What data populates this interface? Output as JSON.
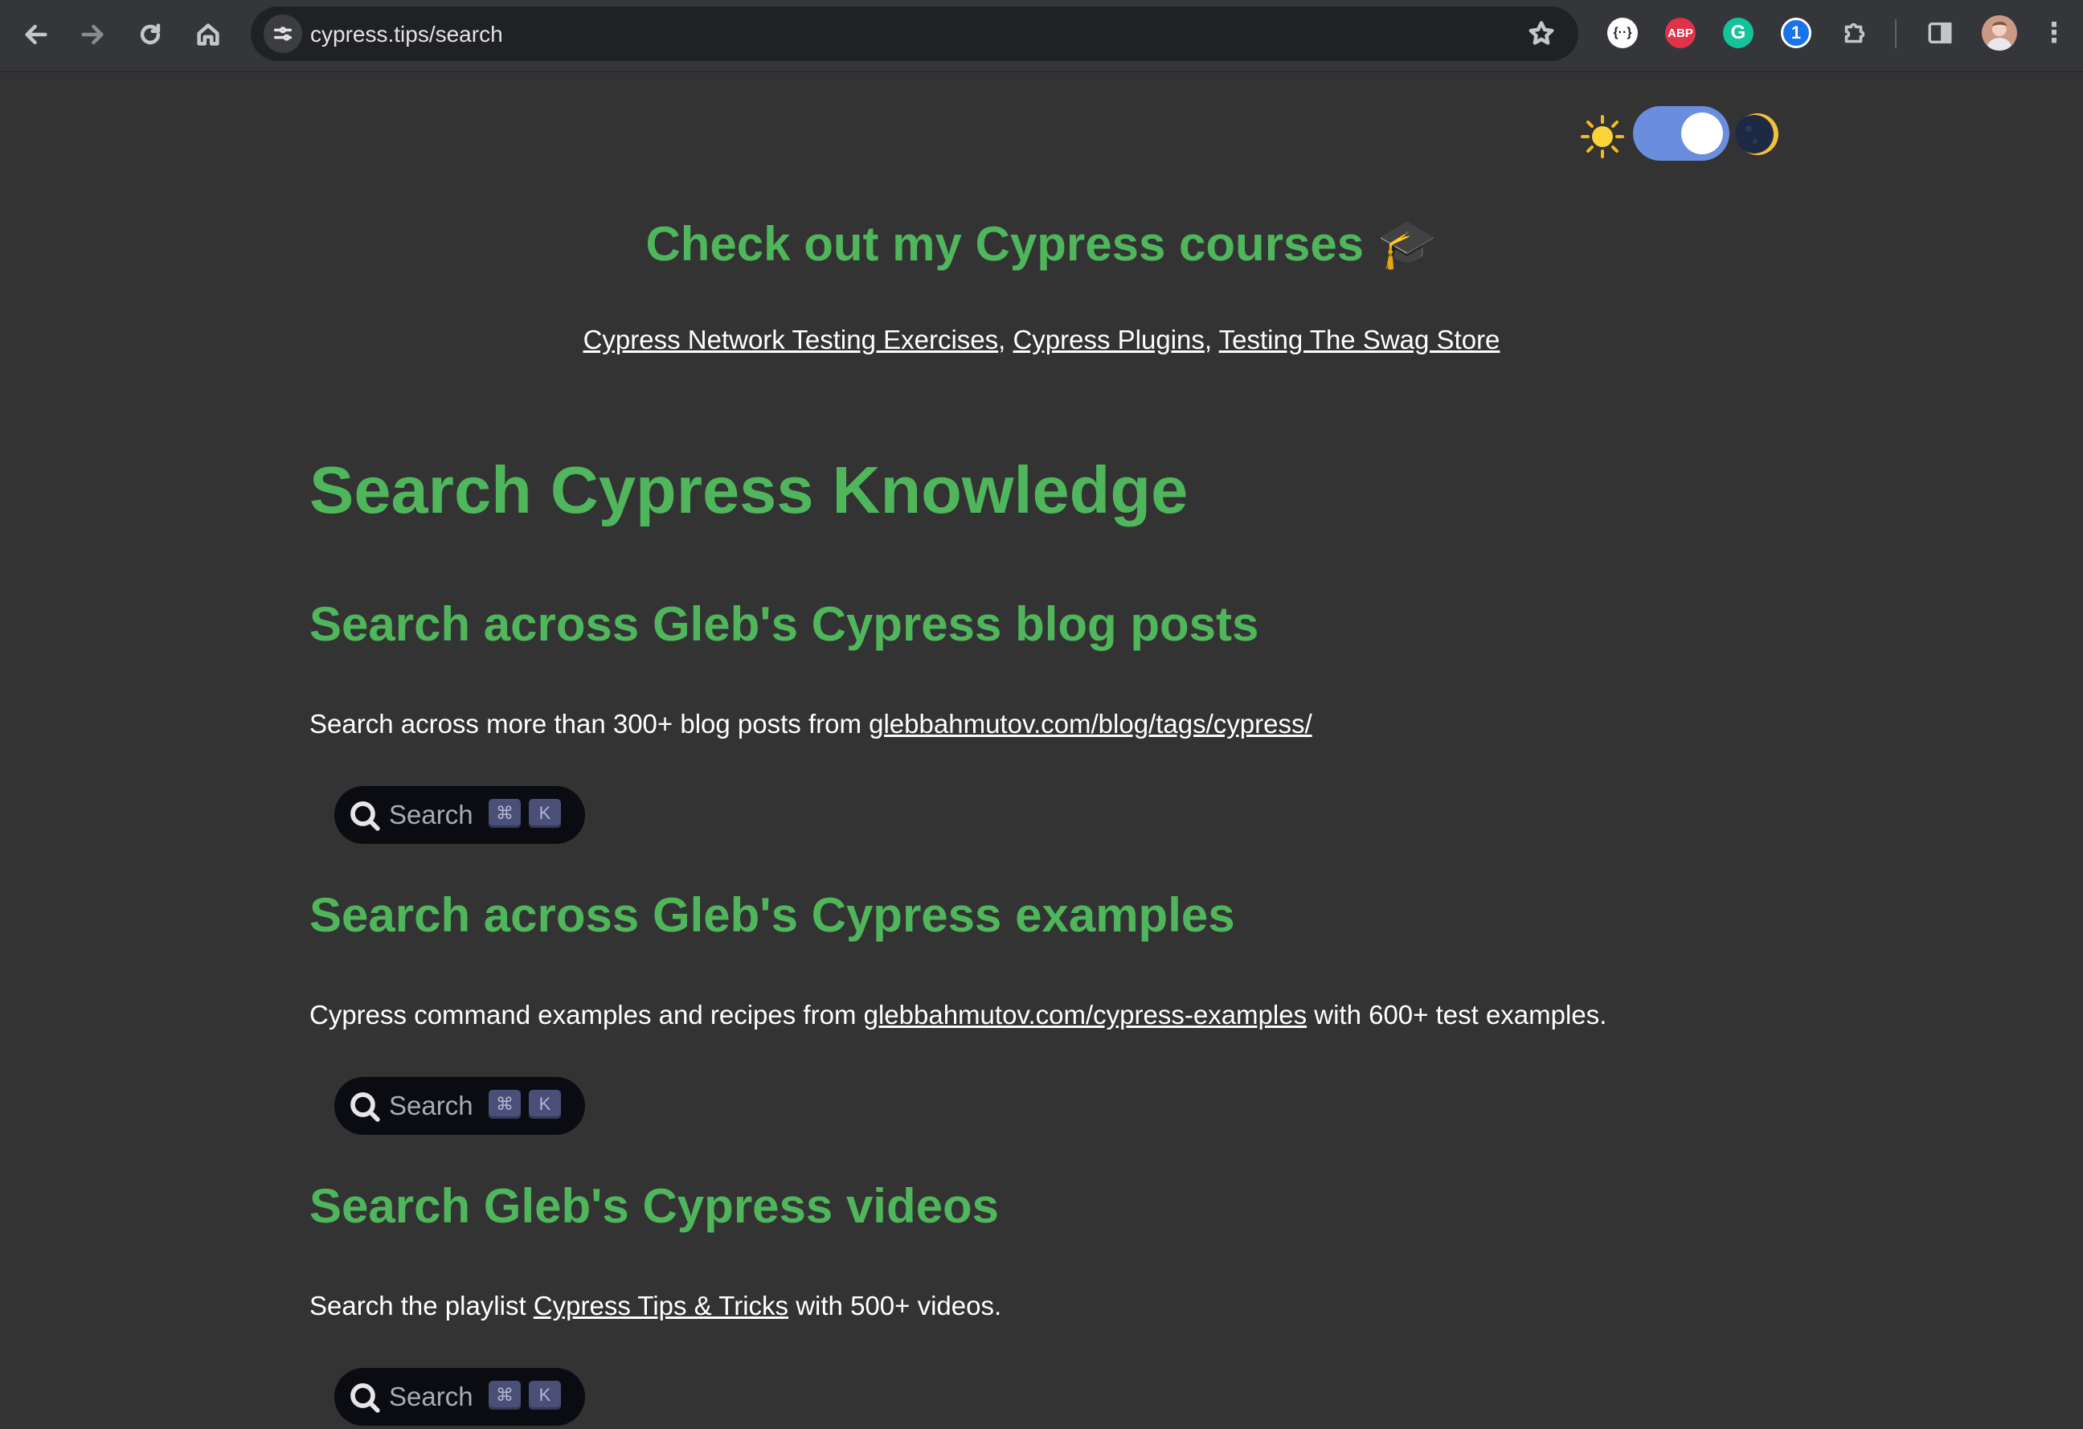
{
  "browser": {
    "url": "cypress.tips/search"
  },
  "courses": {
    "title": "Check out my Cypress courses 🎓",
    "links": [
      "Cypress Network Testing Exercises",
      "Cypress Plugins",
      "Testing The Swag Store"
    ],
    "separator": ","
  },
  "page": {
    "title": "Search Cypress Knowledge"
  },
  "sections": [
    {
      "heading": "Search across Gleb's Cypress blog posts",
      "text_before": "Search across more than 300+ blog posts from ",
      "link": "glebbahmutov.com/blog/tags/cypress/",
      "text_after": ""
    },
    {
      "heading": "Search across Gleb's Cypress examples",
      "text_before": "Cypress command examples and recipes from ",
      "link": "glebbahmutov.com/cypress-examples",
      "text_after": " with 600+ test examples."
    },
    {
      "heading": "Search Gleb's Cypress videos",
      "text_before": "Search the playlist ",
      "link": "Cypress Tips & Tricks",
      "text_after": " with 500+ videos."
    }
  ],
  "search_button": {
    "label": "Search",
    "key_cmd": "⌘",
    "key_k": "K"
  },
  "colors": {
    "accent_green": "#4fb65c",
    "background": "#333333",
    "toggle": "#6b8de0"
  }
}
